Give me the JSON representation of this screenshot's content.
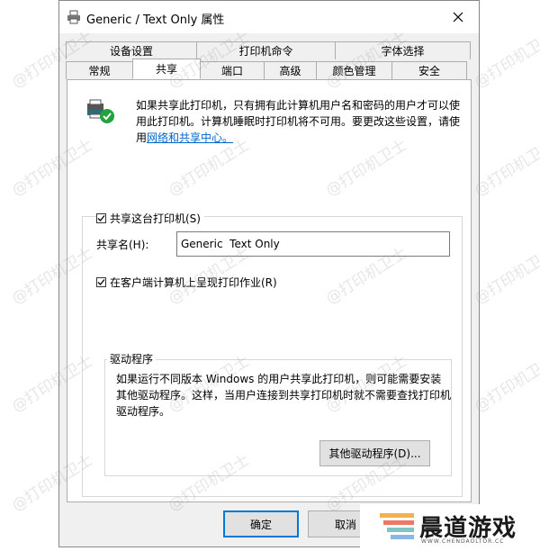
{
  "window": {
    "title": "Generic / Text Only 属性",
    "icon": "printer-icon"
  },
  "tabs": {
    "row1": [
      "设备设置",
      "打印机命令",
      "字体选择"
    ],
    "row2": [
      "常规",
      "共享",
      "端口",
      "高级",
      "颜色管理",
      "安全"
    ],
    "active": "共享"
  },
  "info": {
    "text": "如果共享此打印机，只有拥有此计算机用户名和密码的用户才可以使用此打印机。计算机睡眠时打印机将不可用。要更改这些设置，请使用",
    "link": "网络和共享中心。"
  },
  "share": {
    "checkbox_label": "共享这台打印机(S)",
    "checked": true,
    "name_label": "共享名(H):",
    "name_value": "Generic  Text Only",
    "render_label": "在客户端计算机上呈现打印作业(R)",
    "render_checked": true
  },
  "drivers": {
    "legend": "驱动程序",
    "text": "如果运行不同版本 Windows 的用户共享此打印机，则可能需要安装其他驱动程序。这样，当用户连接到共享打印机时就不需要查找打印机驱动程序。",
    "button": "其他驱动程序(D)..."
  },
  "buttons": {
    "ok": "确定",
    "cancel": "取消"
  },
  "watermark": "@打印机卫士",
  "logo": {
    "name": "晨道游戏",
    "sub": "WWW.CHENDAOLTOR.CC"
  },
  "colors": {
    "accent": "#0078d7",
    "link": "#0066cc",
    "check_green": "#22a33b"
  }
}
